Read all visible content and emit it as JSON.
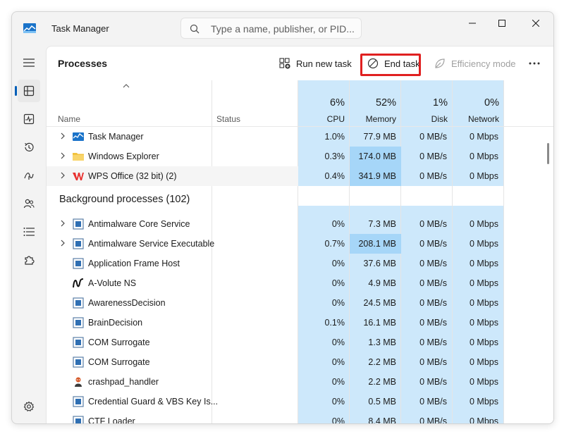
{
  "app": {
    "title": "Task Manager"
  },
  "search": {
    "placeholder": "Type a name, publisher, or PID..."
  },
  "toolbar": {
    "page_title": "Processes",
    "run_new_task": "Run new task",
    "end_task": "End task",
    "efficiency_mode": "Efficiency mode"
  },
  "columns": {
    "name": "Name",
    "status": "Status",
    "cpu": {
      "percent": "6%",
      "label": "CPU"
    },
    "memory": {
      "percent": "52%",
      "label": "Memory"
    },
    "disk": {
      "percent": "1%",
      "label": "Disk"
    },
    "network": {
      "percent": "0%",
      "label": "Network"
    }
  },
  "apps": [
    {
      "name": "Task Manager",
      "icon": "task-manager-icon",
      "cpu": "1.0%",
      "memory": "77.9 MB",
      "disk": "0 MB/s",
      "network": "0 Mbps",
      "expandable": true
    },
    {
      "name": "Windows Explorer",
      "icon": "folder-icon",
      "cpu": "0.3%",
      "memory": "174.0 MB",
      "disk": "0 MB/s",
      "network": "0 Mbps",
      "expandable": true
    },
    {
      "name": "WPS Office (32 bit) (2)",
      "icon": "wps-office-icon",
      "cpu": "0.4%",
      "memory": "341.9 MB",
      "disk": "0 MB/s",
      "network": "0 Mbps",
      "expandable": true
    }
  ],
  "background": {
    "title": "Background processes (102)",
    "rows": [
      {
        "name": "Antimalware Core Service",
        "icon": "service-icon",
        "cpu": "0%",
        "memory": "7.3 MB",
        "disk": "0 MB/s",
        "network": "0 Mbps",
        "expandable": true
      },
      {
        "name": "Antimalware Service Executable",
        "icon": "service-icon",
        "cpu": "0.7%",
        "memory": "208.1 MB",
        "disk": "0 MB/s",
        "network": "0 Mbps",
        "expandable": true
      },
      {
        "name": "Application Frame Host",
        "icon": "service-icon",
        "cpu": "0%",
        "memory": "37.6 MB",
        "disk": "0 MB/s",
        "network": "0 Mbps",
        "expandable": false
      },
      {
        "name": "A-Volute NS",
        "icon": "avolute-icon",
        "cpu": "0%",
        "memory": "4.9 MB",
        "disk": "0 MB/s",
        "network": "0 Mbps",
        "expandable": false
      },
      {
        "name": "AwarenessDecision",
        "icon": "service-icon",
        "cpu": "0%",
        "memory": "24.5 MB",
        "disk": "0 MB/s",
        "network": "0 Mbps",
        "expandable": false
      },
      {
        "name": "BrainDecision",
        "icon": "service-icon",
        "cpu": "0.1%",
        "memory": "16.1 MB",
        "disk": "0 MB/s",
        "network": "0 Mbps",
        "expandable": false
      },
      {
        "name": "COM Surrogate",
        "icon": "service-icon",
        "cpu": "0%",
        "memory": "1.3 MB",
        "disk": "0 MB/s",
        "network": "0 Mbps",
        "expandable": false
      },
      {
        "name": "COM Surrogate",
        "icon": "service-icon",
        "cpu": "0%",
        "memory": "2.2 MB",
        "disk": "0 MB/s",
        "network": "0 Mbps",
        "expandable": false
      },
      {
        "name": "crashpad_handler",
        "icon": "crashpad-icon",
        "cpu": "0%",
        "memory": "2.2 MB",
        "disk": "0 MB/s",
        "network": "0 Mbps",
        "expandable": false
      },
      {
        "name": "Credential Guard & VBS Key Is...",
        "icon": "service-icon",
        "cpu": "0%",
        "memory": "0.5 MB",
        "disk": "0 MB/s",
        "network": "0 Mbps",
        "expandable": false
      },
      {
        "name": "CTF Loader",
        "icon": "service-icon",
        "cpu": "0%",
        "memory": "8.4 MB",
        "disk": "0 MB/s",
        "network": "0 Mbps",
        "expandable": false
      }
    ]
  },
  "colors": {
    "accent": "#005fb8",
    "heat_light": "#cde8fb",
    "heat_dark": "#a6d6f8",
    "highlight_box": "#e02020"
  }
}
